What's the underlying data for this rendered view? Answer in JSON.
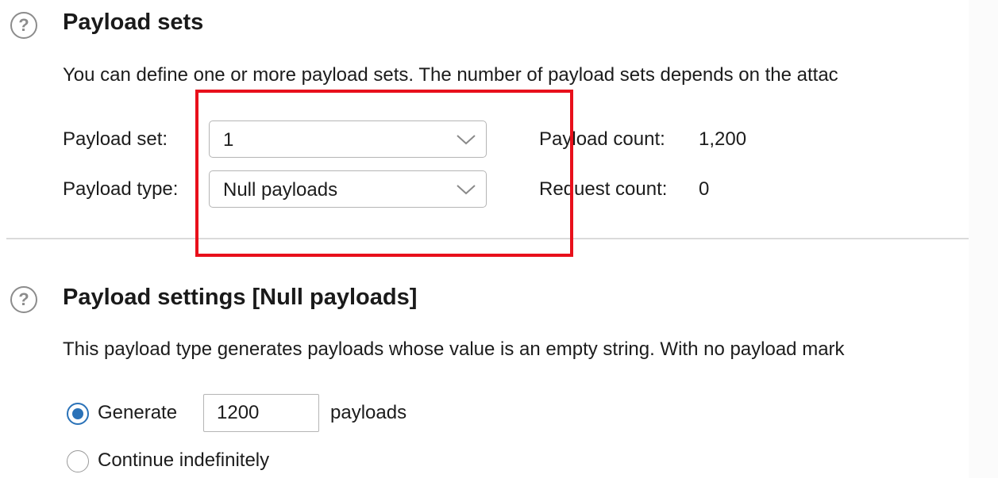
{
  "payload_sets": {
    "help_symbol": "?",
    "heading": "Payload sets",
    "description": "You can define one or more payload sets. The number of payload sets depends on the attac",
    "set_label": "Payload set:",
    "set_value": "1",
    "type_label": "Payload type:",
    "type_value": "Null payloads",
    "payload_count_label": "Payload count:",
    "payload_count_value": "1,200",
    "request_count_label": "Request count:",
    "request_count_value": "0"
  },
  "payload_settings": {
    "help_symbol": "?",
    "heading": "Payload settings [Null payloads]",
    "description": "This payload type generates payloads whose value is an empty string. With no payload mark",
    "generate_label": "Generate",
    "generate_value": "1200",
    "generate_suffix": "payloads",
    "generate_selected": true,
    "continue_label": "Continue indefinitely",
    "continue_selected": false
  },
  "colors": {
    "accent": "#2a72b8",
    "highlight": "#e8101b",
    "help_icon": "#8c8c8c"
  },
  "icons": {
    "help": "help-circle-icon",
    "dropdown": "chevron-down-icon"
  }
}
